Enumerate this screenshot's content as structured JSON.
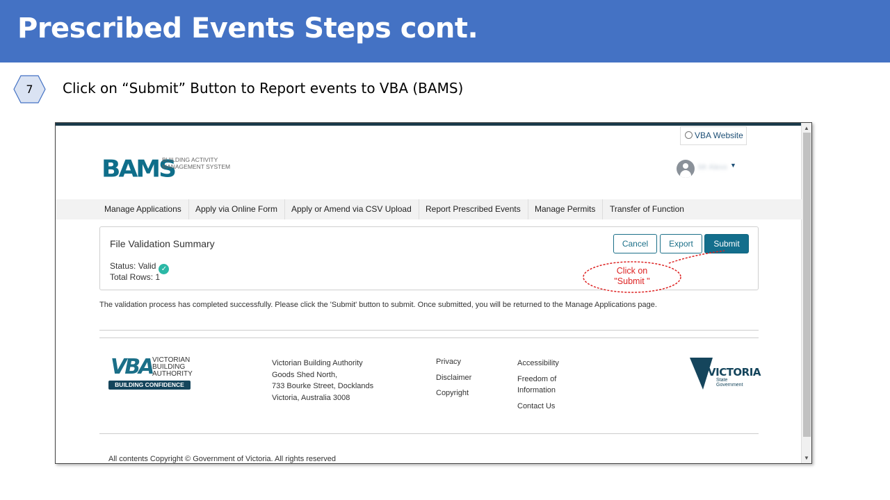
{
  "slide": {
    "title": "Prescribed Events Steps cont.",
    "step_number": "7",
    "instruction": "Click on “Submit” Button to Report events to VBA (BAMS)"
  },
  "header": {
    "vba_website_link": "VBA Website",
    "logo_text": "BAMS",
    "logo_subtitle": "BUILDING ACTIVITY MANAGEMENT SYSTEM",
    "user_name": "Mr Alexx"
  },
  "nav": {
    "items": [
      {
        "label": "Manage Applications"
      },
      {
        "label": "Apply via Online Form"
      },
      {
        "label": "Apply or Amend via CSV Upload"
      },
      {
        "label": "Report Prescribed Events"
      },
      {
        "label": "Manage Permits"
      },
      {
        "label": "Transfer of Function"
      }
    ]
  },
  "summary": {
    "title": "File Validation Summary",
    "status_label": "Status: Valid",
    "total_rows": "Total Rows: 1",
    "cancel_label": "Cancel",
    "export_label": "Export",
    "submit_label": "Submit"
  },
  "callout": {
    "line1": "Click on",
    "line2": "\"Submit \"",
    "color": "#dd2222"
  },
  "validation_message": "The validation process has completed successfully. Please click the 'Submit' button to submit. Once submitted, you will be returned to the Manage Applications page.",
  "footer": {
    "vba_logo_text": "VBA",
    "vba_logo_subtitle": "VICTORIAN BUILDING AUTHORITY",
    "vba_badge": "BUILDING CONFIDENCE",
    "address_lines": [
      "Victorian Building Authority",
      "Goods Shed North,",
      "733 Bourke Street, Docklands",
      "Victoria, Australia 3008"
    ],
    "links_col1": [
      "Privacy",
      "Disclaimer",
      "Copyright"
    ],
    "links_col2": {
      "accessibility": "Accessibility",
      "foi_line1": "Freedom of",
      "foi_line2": "Information",
      "contact": "Contact Us"
    },
    "vic_logo_text": "VICTORIA",
    "vic_logo_sub1": "State",
    "vic_logo_sub2": "Government",
    "copyright": "All contents Copyright © Government of Victoria. All rights reserved"
  },
  "colors": {
    "slide_header": "#4472c4",
    "brand_teal": "#136e8c",
    "success_check": "#2bb8a6"
  },
  "icons": {
    "globe": "globe-icon",
    "user": "user-avatar-icon",
    "check": "check-circle-icon",
    "caret": "caret-down-icon"
  }
}
